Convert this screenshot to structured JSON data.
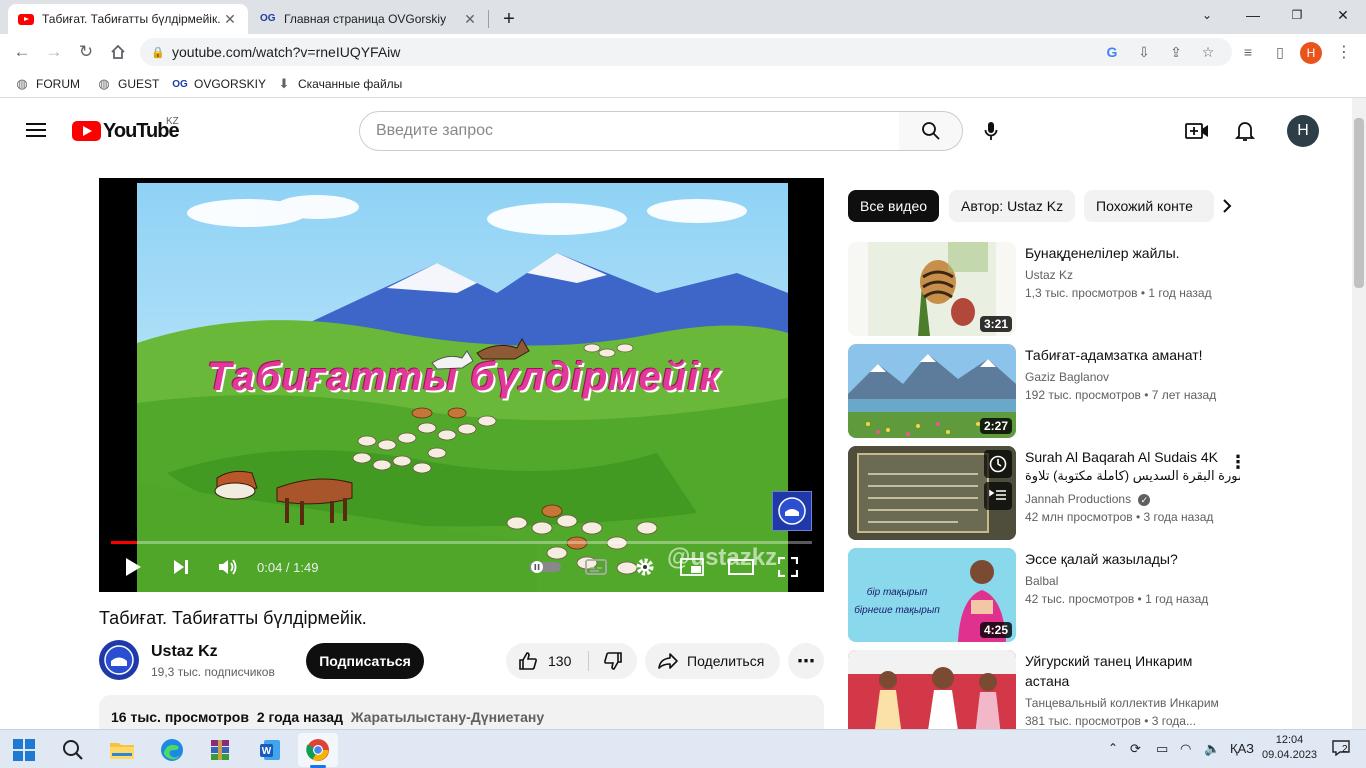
{
  "browser": {
    "tabs": [
      {
        "title": "Табиғат. Табиғатты бүлдірмейік.",
        "favicon": "youtube-icon",
        "active": true
      },
      {
        "title": "Главная страница OVGorskiy",
        "favicon": "ovgorskiy-icon",
        "active": false
      }
    ],
    "new_tab": "+",
    "url": "youtube.com/watch?v=rneIUQYFAiw",
    "profile_letter": "H",
    "bookmarks": [
      {
        "label": "FORUM",
        "icon": "globe-icon"
      },
      {
        "label": "GUEST",
        "icon": "globe-icon"
      },
      {
        "label": "OVGORSKIY",
        "icon": "ovgorskiy-icon"
      },
      {
        "label": "Скачанные файлы",
        "icon": "download-icon"
      }
    ]
  },
  "youtube": {
    "logo_text": "YouTube",
    "country_code": "KZ",
    "search_placeholder": "Введите запрос",
    "avatar_letter": "H"
  },
  "player": {
    "overlay_title": "Табиғатты бүлдірмейік",
    "watermark": "@ustazkz",
    "current_time": "0:04",
    "duration": "1:49",
    "time_label": "0:04 / 1:49",
    "progress_fraction": 0.037
  },
  "video": {
    "title": "Табиғат. Табиғатты бүлдірмейік.",
    "channel": "Ustaz Kz",
    "subscribers": "19,3 тыс. подписчиков",
    "subscribe_label": "Подписаться",
    "likes": "130",
    "share_label": "Поделиться",
    "views": "16 тыс. просмотров",
    "published": "2 года назад",
    "tag": "Жаратылыстану-Дүниетану"
  },
  "sidebar": {
    "chips": [
      "Все видео",
      "Автор: Ustaz Kz",
      "Похожий конте"
    ],
    "recommendations": [
      {
        "title": "Бунақденелілер жайлы.",
        "channel": "Ustaz Kz",
        "meta": "1,3 тыс. просмотров • 1 год назад",
        "duration": "3:21",
        "verified": false
      },
      {
        "title": "Табиғат-адамзатка аманат!",
        "channel": "Gaziz Baglanov",
        "meta": "192 тыс. просмотров • 7 лет назад",
        "duration": "2:27",
        "verified": false
      },
      {
        "title": "Surah Al Baqarah Al Sudais 4K",
        "title2": "سورة البقرة السديس (كاملة مكتوبة) تلاوة...",
        "channel": "Jannah Productions",
        "meta": "42 млн просмотров • 3 года назад",
        "duration": "",
        "verified": true
      },
      {
        "title": "Эссе қалай жазылады?",
        "channel": "Balbal",
        "meta": "42 тыс. просмотров • 1 год назад",
        "duration": "4:25",
        "verified": false,
        "thumb_text_1": "бір тақырып",
        "thumb_text_2": "бірнеше тақырып"
      },
      {
        "title": "Уйгурский танец Инкарим астана",
        "channel": "Танцевальный коллектив Инкарим",
        "meta": "381 тыс. просмотров • 3 года...",
        "duration": "",
        "verified": false
      }
    ]
  },
  "taskbar": {
    "language": "ҚАЗ",
    "time": "12:04",
    "date": "09.04.2023",
    "notifications": "2"
  }
}
